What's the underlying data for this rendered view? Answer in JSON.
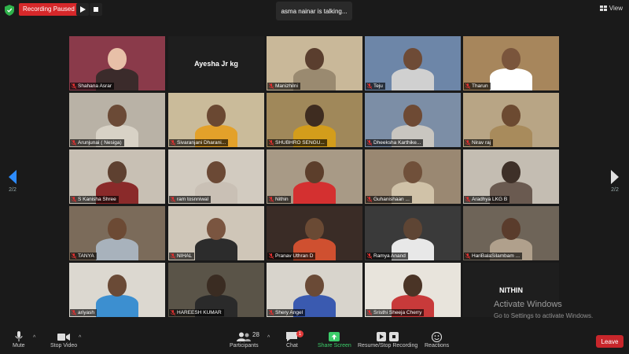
{
  "topbar": {
    "recording_label": "Recording Paused",
    "talking_label": "asma nainar is talking...",
    "view_label": "View"
  },
  "nav": {
    "left_page": "2/2",
    "right_page": "2/2"
  },
  "tiles": [
    {
      "name": "Shahana Asrar"
    },
    {
      "name": "",
      "display": "Ayesha Jr kg"
    },
    {
      "name": "Manizhilni"
    },
    {
      "name": "Teju"
    },
    {
      "name": "Tharun"
    },
    {
      "name": "Arunjunai ( Nesiga)"
    },
    {
      "name": "Sivaranjani Dharani..."
    },
    {
      "name": "SHUBHRO SENGU..."
    },
    {
      "name": "Dheeksha Karthike..."
    },
    {
      "name": "Nirav raj"
    },
    {
      "name": "S Kanisha Shree"
    },
    {
      "name": "ram tosnniwal"
    },
    {
      "name": "Nithin"
    },
    {
      "name": "Guhanishaan ..."
    },
    {
      "name": "Aradhya LKG B"
    },
    {
      "name": "TANYA"
    },
    {
      "name": "NIHAL"
    },
    {
      "name": "Pranav Uthran D"
    },
    {
      "name": "Ramya Anand"
    },
    {
      "name": "HariBalaSilambam ..."
    },
    {
      "name": "ariyash"
    },
    {
      "name": "HAREESH KUMAR"
    },
    {
      "name": "Shery Angel"
    },
    {
      "name": "Sristhi Sheeja Cherry"
    },
    {
      "name": "",
      "display": "NITHIN"
    }
  ],
  "watermark": {
    "title": "Activate Windows",
    "subtitle": "Go to Settings to activate Windows."
  },
  "toolbar": {
    "mute": "Mute",
    "stop_video": "Stop Video",
    "participants": "Participants",
    "participants_count": "28",
    "chat": "Chat",
    "chat_badge": "1",
    "share": "Share Screen",
    "record": "Resume/Stop Recording",
    "reactions": "Reactions",
    "leave": "Leave"
  },
  "colors": {
    "record_red": "#d6282a",
    "share_green": "#3ccd6a",
    "leave_red": "#c8262b"
  }
}
